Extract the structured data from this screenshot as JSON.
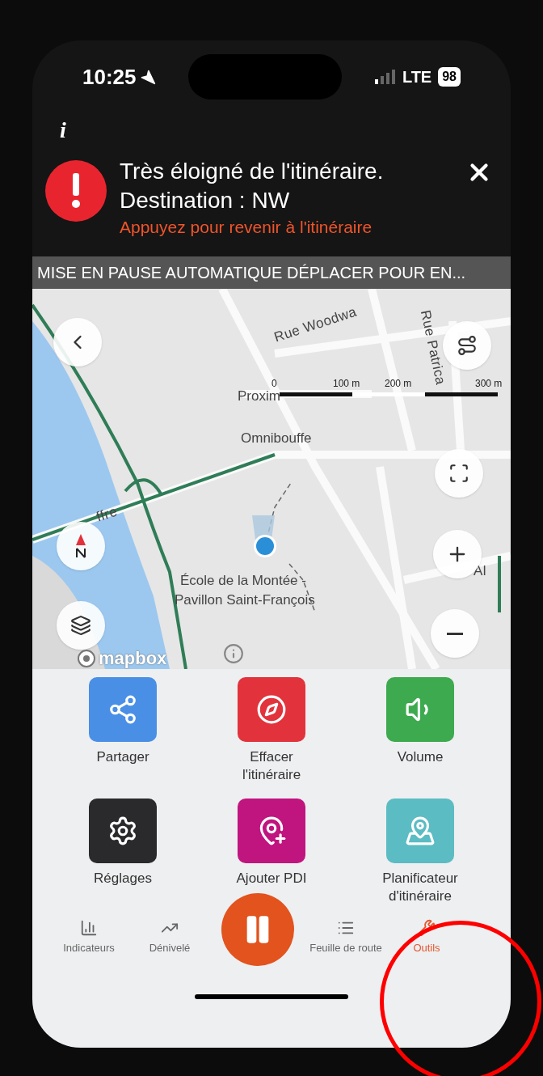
{
  "status_bar": {
    "time": "10:25",
    "network": "LTE",
    "battery": "98"
  },
  "info_mark": "i",
  "alert": {
    "title": [
      "Très éloigné de l'itinéraire.",
      "Destination : NW"
    ],
    "action": "Appuyez pour revenir à l'itinéraire"
  },
  "banner": "MISE EN PAUSE AUTOMATIQUE DÉPLACER POUR EN...",
  "map": {
    "labels": [
      {
        "text": "Rue Woodwa",
        "kind": "street"
      },
      {
        "text": "Rue Patrica",
        "kind": "street"
      },
      {
        "text": "Proxim",
        "kind": "place"
      },
      {
        "text": "Omnibouffe",
        "kind": "place"
      },
      {
        "text": "ffre",
        "kind": "street"
      },
      {
        "text": "École de la Montée -",
        "kind": "place"
      },
      {
        "text": "Pavillon Saint-François",
        "kind": "place"
      },
      {
        "text": "Al",
        "kind": "street"
      }
    ],
    "scale": [
      "0",
      "100 m",
      "200 m",
      "300 m"
    ],
    "attribution": "mapbox"
  },
  "actions": [
    {
      "label": "Partager",
      "color": "#4a8fe6"
    },
    {
      "label": "Effacer l'itinéraire",
      "color": "#e2323b"
    },
    {
      "label": "Volume",
      "color": "#3daa4f"
    },
    {
      "label": "Réglages",
      "color": "#2a2a2c"
    },
    {
      "label": "Ajouter PDI",
      "color": "#c0157e"
    },
    {
      "label": "Planificateur d'itinéraire",
      "color": "#5bbcc3"
    }
  ],
  "nav": [
    {
      "label": "Indicateurs",
      "selected": false
    },
    {
      "label": "Dénivelé",
      "selected": false
    },
    {
      "label": "Feuille de route",
      "selected": false
    },
    {
      "label": "Outils",
      "selected": true
    }
  ]
}
